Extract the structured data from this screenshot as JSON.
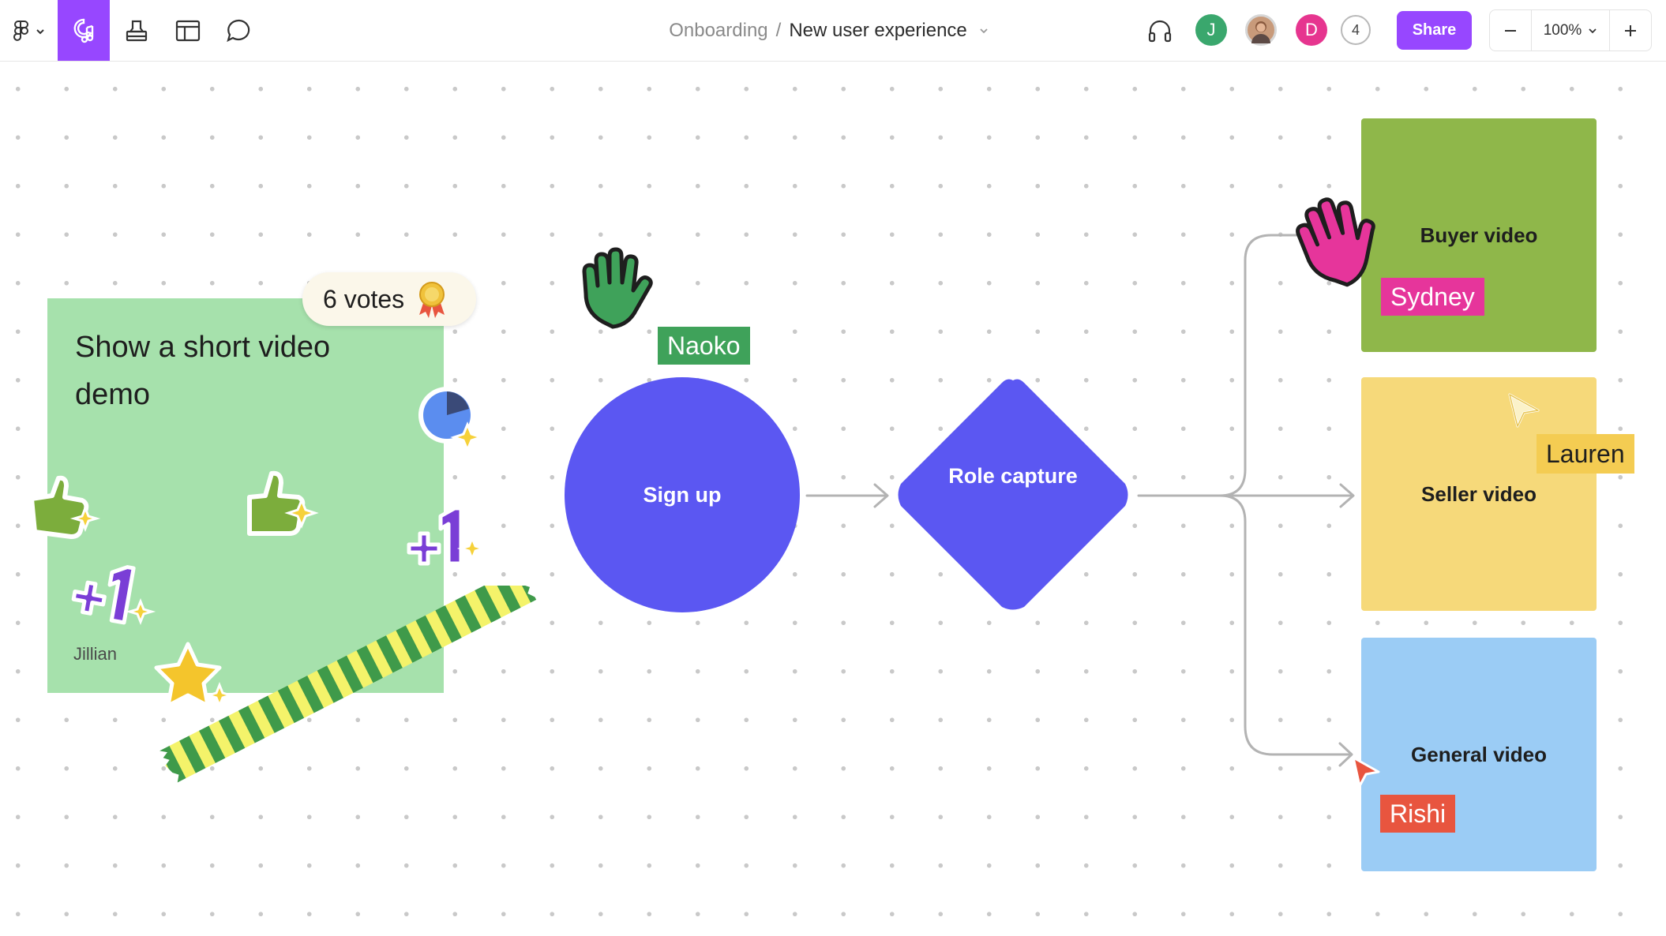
{
  "toolbar": {
    "tools": [
      {
        "icon": "figma-logo-menu-icon",
        "active": false
      },
      {
        "icon": "sticker-music-tool-icon",
        "active": true
      },
      {
        "icon": "stamp-tool-icon",
        "active": false
      },
      {
        "icon": "table-layout-icon",
        "active": false
      },
      {
        "icon": "comment-icon",
        "active": false
      }
    ],
    "breadcrumb": {
      "parent": "Onboarding",
      "separator": "/",
      "current": "New user experience"
    },
    "avatars": [
      {
        "label": "J",
        "color": "#3aa76d"
      },
      {
        "label": "",
        "color": "#c89a7a"
      },
      {
        "label": "D",
        "color": "#e6358f"
      }
    ],
    "collaborator_count": "4",
    "share_label": "Share",
    "zoom": "100%",
    "accent": "#9747ff"
  },
  "canvas": {
    "sticky": {
      "text": "Show a short video demo",
      "author": "Jillian",
      "votes": "6 votes",
      "color": "#a6e1ac"
    },
    "flow": {
      "signup": "Sign up",
      "role": "Role capture",
      "shape_color": "#5b57f2",
      "buyer": "Buyer video",
      "seller": "Seller video",
      "general": "General video"
    },
    "cursors": {
      "naoko": "Naoko",
      "sydney": "Sydney",
      "lauren": "Lauren",
      "rishi": "Rishi"
    }
  }
}
